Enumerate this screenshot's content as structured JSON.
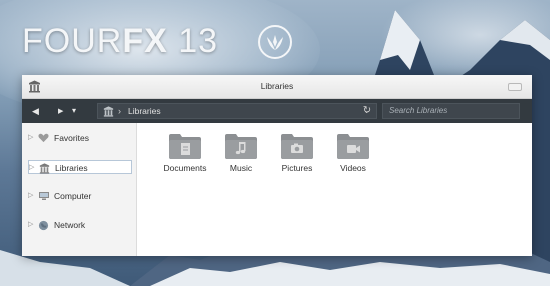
{
  "brand": {
    "prefix": "FOUR",
    "fx": "FX",
    "number": " 13"
  },
  "window": {
    "title": "Libraries"
  },
  "navbar": {
    "back": "◀",
    "forward": "▶",
    "dropdown": "▾",
    "crumb_sep": "›",
    "crumb": "Libraries",
    "address_dropdown": "⌄",
    "refresh": "↻",
    "search_placeholder": "Search Libraries"
  },
  "sidebar": {
    "items": [
      {
        "label": "Favorites",
        "icon": "heart-icon"
      },
      {
        "label": "Libraries",
        "icon": "library-icon",
        "selected": true
      },
      {
        "label": "Computer",
        "icon": "computer-icon"
      },
      {
        "label": "Network",
        "icon": "network-icon"
      }
    ]
  },
  "folders": [
    {
      "label": "Documents",
      "icon": "document-icon"
    },
    {
      "label": "Music",
      "icon": "music-note-icon"
    },
    {
      "label": "Pictures",
      "icon": "camera-icon"
    },
    {
      "label": "Videos",
      "icon": "video-camera-icon"
    }
  ],
  "colors": {
    "navbar": "#333a40",
    "folder": "#8c8f92",
    "accent": "#b7c7d8"
  }
}
